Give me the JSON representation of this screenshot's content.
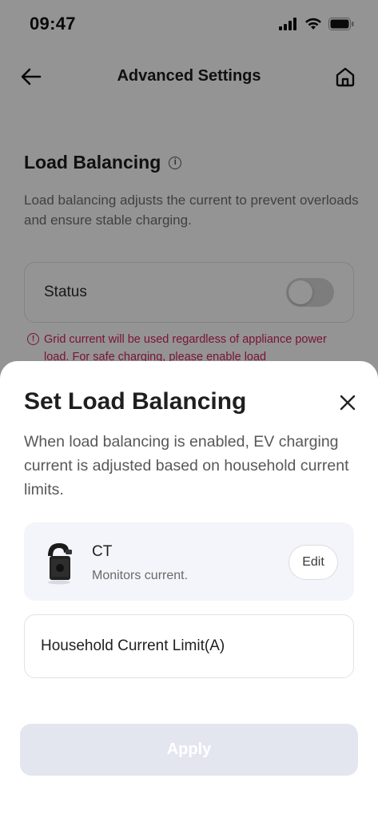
{
  "status_bar": {
    "time": "09:47",
    "icons": [
      "signal-icon",
      "wifi-icon",
      "battery-icon"
    ]
  },
  "nav": {
    "title": "Advanced Settings",
    "back_icon": "arrow-left-icon",
    "home_icon": "home-icon"
  },
  "load_balancing": {
    "title": "Load Balancing",
    "info_icon": "info-icon",
    "description": "Load balancing adjusts the current to prevent overloads and ensure stable charging.",
    "status_label": "Status",
    "status_enabled": false,
    "warning": "Grid current will be used regardless of appliance power load. For safe charging, please enable load"
  },
  "sheet": {
    "title": "Set Load Balancing",
    "close_icon": "close-icon",
    "description": "When load balancing is enabled, EV charging current is adjusted based on household current limits.",
    "ct": {
      "name": "CT",
      "subtitle": "Monitors current.",
      "edit_label": "Edit",
      "image_icon": "ct-clamp-icon"
    },
    "limit_label": "Household Current Limit(A)",
    "apply_label": "Apply"
  },
  "colors": {
    "warning": "#d0245a",
    "apply_disabled_bg": "#e3e6ef",
    "ct_card_bg": "#f4f5fa"
  }
}
